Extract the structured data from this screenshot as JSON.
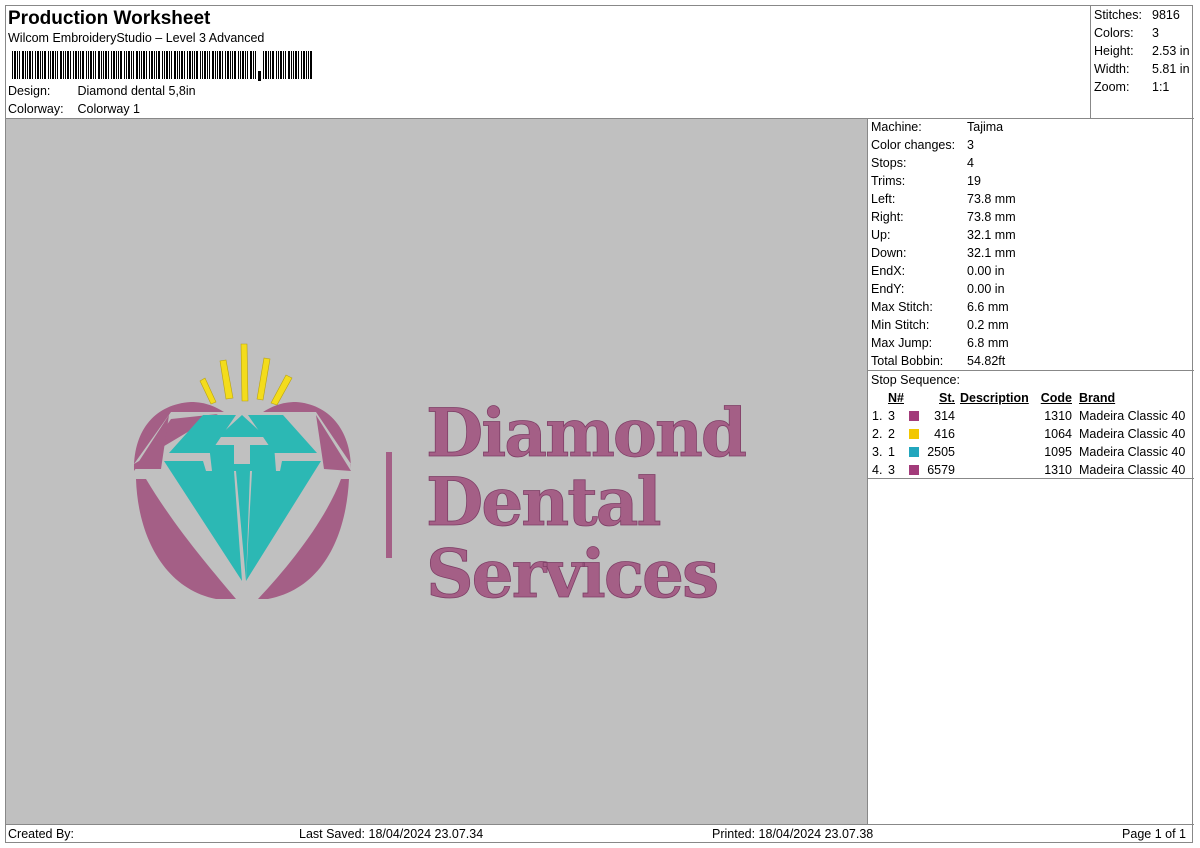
{
  "header": {
    "title": "Production Worksheet",
    "subtitle": "Wilcom EmbroideryStudio – Level 3 Advanced",
    "design_label": "Design:",
    "design_value": "Diamond dental 5,8in",
    "colorway_label": "Colorway:",
    "colorway_value": "Colorway 1"
  },
  "summary": [
    {
      "label": "Stitches:",
      "value": "9816"
    },
    {
      "label": "Colors:",
      "value": "3"
    },
    {
      "label": "Height:",
      "value": "2.53 in"
    },
    {
      "label": "Width:",
      "value": "5.81 in"
    },
    {
      "label": "Zoom:",
      "value": "1:1"
    }
  ],
  "machine": [
    {
      "label": "Machine:",
      "value": "Tajima"
    },
    {
      "label": "Color changes:",
      "value": "3"
    },
    {
      "label": "Stops:",
      "value": "4"
    },
    {
      "label": "Trims:",
      "value": "19"
    },
    {
      "label": "Left:",
      "value": "73.8 mm"
    },
    {
      "label": "Right:",
      "value": "73.8 mm"
    },
    {
      "label": "Up:",
      "value": "32.1 mm"
    },
    {
      "label": "Down:",
      "value": "32.1 mm"
    },
    {
      "label": "EndX:",
      "value": "0.00 in"
    },
    {
      "label": "EndY:",
      "value": "0.00 in"
    },
    {
      "label": "Max Stitch:",
      "value": "6.6 mm"
    },
    {
      "label": "Min Stitch:",
      "value": "0.2 mm"
    },
    {
      "label": "Max Jump:",
      "value": "6.8 mm"
    },
    {
      "label": "Total Bobbin:",
      "value": "54.82ft"
    }
  ],
  "stop_sequence": {
    "caption": "Stop Sequence:",
    "headers": {
      "n": "N#",
      "st": "St.",
      "description": "Description",
      "code": "Code",
      "brand": "Brand"
    },
    "rows": [
      {
        "idx": "1.",
        "n": "3",
        "color": "#a23b7a",
        "st": "314",
        "description": "",
        "code": "1310",
        "brand": "Madeira Classic 40"
      },
      {
        "idx": "2.",
        "n": "2",
        "color": "#f2c700",
        "st": "416",
        "description": "",
        "code": "1064",
        "brand": "Madeira Classic 40"
      },
      {
        "idx": "3.",
        "n": "1",
        "color": "#22a6bd",
        "st": "2505",
        "description": "",
        "code": "1095",
        "brand": "Madeira Classic 40"
      },
      {
        "idx": "4.",
        "n": "3",
        "color": "#a23b7a",
        "st": "6579",
        "description": "",
        "code": "1310",
        "brand": "Madeira Classic 40"
      }
    ]
  },
  "design": {
    "text_line1": "Diamond",
    "text_line2": "Dental",
    "text_line3": "Services",
    "colors": {
      "mauve": "#a45f86",
      "teal": "#2cb8b4",
      "gold": "#f3dc1c",
      "background": "#c0c0c0"
    }
  },
  "footer": {
    "created_by": "Created By:",
    "last_saved": "Last Saved: 18/04/2024 23.07.34",
    "printed": "Printed: 18/04/2024 23.07.38",
    "page": "Page 1 of 1"
  }
}
